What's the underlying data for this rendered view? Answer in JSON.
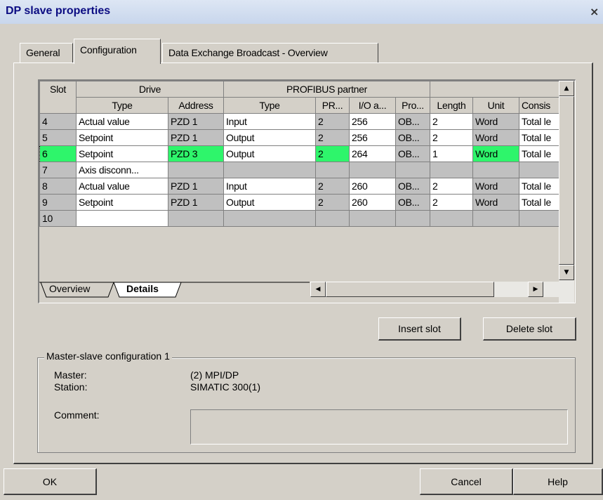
{
  "window": {
    "title": "DP slave properties",
    "close_glyph": "×"
  },
  "tabs": [
    {
      "label": "General",
      "active": false
    },
    {
      "label": "Configuration",
      "active": true
    },
    {
      "label": "Data Exchange Broadcast - Overview",
      "active": false
    }
  ],
  "grid": {
    "group_headers": {
      "slot": "Slot",
      "drive": "Drive",
      "partner": "PROFIBUS partner"
    },
    "columns": [
      "Type",
      "Address",
      "Type",
      "PR...",
      "I/O a...",
      "Pro...",
      "Length",
      "Unit",
      "Consis"
    ],
    "rows": [
      {
        "slot": "4",
        "cells": [
          "Actual value",
          "PZD 1",
          "Input",
          "2",
          "256",
          "OB...",
          "2",
          "Word",
          "Total le"
        ],
        "state": "normal"
      },
      {
        "slot": "5",
        "cells": [
          "Setpoint",
          "PZD 1",
          "Output",
          "2",
          "256",
          "OB...",
          "2",
          "Word",
          "Total le"
        ],
        "state": "normal"
      },
      {
        "slot": "6",
        "cells": [
          "Setpoint",
          "PZD 3",
          "Output",
          "2",
          "264",
          "OB...",
          "1",
          "Word",
          "Total le"
        ],
        "state": "selected"
      },
      {
        "slot": "7",
        "cells": [
          "Axis disconn...",
          "",
          "",
          "",
          "",
          "",
          "",
          "",
          ""
        ],
        "state": "gray"
      },
      {
        "slot": "8",
        "cells": [
          "Actual value",
          "PZD 1",
          "Input",
          "2",
          "260",
          "OB...",
          "2",
          "Word",
          "Total le"
        ],
        "state": "normal"
      },
      {
        "slot": "9",
        "cells": [
          "Setpoint",
          "PZD 1",
          "Output",
          "2",
          "260",
          "OB...",
          "2",
          "Word",
          "Total le"
        ],
        "state": "normal"
      },
      {
        "slot": "10",
        "cells": [
          "",
          "",
          "",
          "",
          "",
          "",
          "",
          "",
          ""
        ],
        "state": "empty"
      }
    ],
    "highlight_color": "#2ef56b"
  },
  "view_tabs": {
    "overview": "Overview",
    "details": "Details"
  },
  "actions": {
    "insert_slot": "Insert slot",
    "delete_slot": "Delete slot"
  },
  "master_slave": {
    "group_title": "Master-slave configuration 1",
    "master_label": "Master:",
    "master_value": "(2) MPI/DP",
    "station_label": "Station:",
    "station_value": "SIMATIC 300(1)",
    "comment_label": "Comment:",
    "comment_value": ""
  },
  "footer": {
    "ok": "OK",
    "cancel": "Cancel",
    "help": "Help"
  }
}
